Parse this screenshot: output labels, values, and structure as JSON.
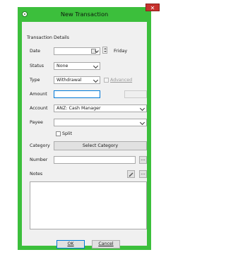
{
  "window": {
    "title": "New Transaction",
    "close_glyph": "✕",
    "section_label": "Transaction Details"
  },
  "form": {
    "date": {
      "label": "Date",
      "value": "",
      "day": "Friday"
    },
    "status": {
      "label": "Status",
      "value": "None"
    },
    "type": {
      "label": "Type",
      "value": "Withdrawal",
      "advanced_label": "Advanced"
    },
    "amount": {
      "label": "Amount",
      "value": ""
    },
    "account": {
      "label": "Account",
      "value": "ANZ: Cash Manager"
    },
    "payee": {
      "label": "Payee",
      "value": "",
      "split_label": "Split"
    },
    "category": {
      "label": "Category",
      "button": "Select Category"
    },
    "number": {
      "label": "Number",
      "value": "",
      "browse": "..."
    },
    "notes": {
      "label": "Notes",
      "browse": "..."
    }
  },
  "buttons": {
    "ok": "OK",
    "cancel": "Cancel"
  },
  "colors": {
    "window_border": "#3cbf3c",
    "close": "#c7322e",
    "focus": "#0078d7"
  },
  "icons": {
    "app": "app-icon",
    "edit": "pencil-icon",
    "calendar": "calendar-icon"
  }
}
